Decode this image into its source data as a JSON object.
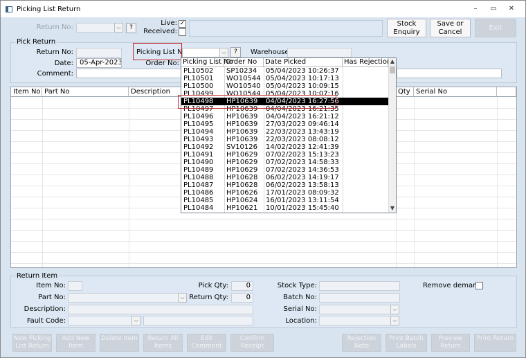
{
  "window": {
    "title": "Picking List Return"
  },
  "top": {
    "return_no_label": "Return No:",
    "live_label": "Live:",
    "received_label": "Received:",
    "help": "?",
    "stock_enquiry": "Stock Enquiry",
    "save_cancel": "Save or Cancel",
    "exit": "Exit"
  },
  "pick_return": {
    "title": "Pick Return",
    "return_no_label": "Return No:",
    "date_label": "Date:",
    "date_value": "05-Apr-2023",
    "comment_label": "Comment:",
    "picking_list_label": "Picking List No:",
    "order_no_label": "Order No:",
    "warehouse_label": "Warehouse:",
    "help": "?"
  },
  "grid": {
    "columns": [
      "Item No",
      "Part No",
      "Description",
      "Qty",
      "Serial No"
    ]
  },
  "picking_dropdown": {
    "columns": [
      "Picking List No",
      "Order No",
      "Date Picked",
      "Has Rejections"
    ],
    "rows": [
      [
        "PL10502",
        "SP10234",
        "05/04/2023 10:26:37"
      ],
      [
        "PL10501",
        "WO10544",
        "05/04/2023 10:17:13"
      ],
      [
        "PL10500",
        "WO10540",
        "05/04/2023 10:09:15"
      ],
      [
        "PL10499",
        "WO10544",
        "05/04/2023 10:07:16"
      ],
      [
        "PL10498",
        "HP10639",
        "04/04/2023 16:27:56"
      ],
      [
        "PL10497",
        "HP10639",
        "04/04/2023 16:21:35"
      ],
      [
        "PL10496",
        "HP10639",
        "04/04/2023 16:21:12"
      ],
      [
        "PL10495",
        "HP10639",
        "27/03/2023 09:46:14"
      ],
      [
        "PL10494",
        "HP10639",
        "22/03/2023 13:43:19"
      ],
      [
        "PL10493",
        "HP10639",
        "22/03/2023 08:08:12"
      ],
      [
        "PL10492",
        "SV10126",
        "14/02/2023 12:41:39"
      ],
      [
        "PL10491",
        "HP10629",
        "07/02/2023 15:13:23"
      ],
      [
        "PL10490",
        "HP10629",
        "07/02/2023 14:58:33"
      ],
      [
        "PL10489",
        "HP10629",
        "07/02/2023 14:36:53"
      ],
      [
        "PL10488",
        "HP10628",
        "06/02/2023 14:19:17"
      ],
      [
        "PL10487",
        "HP10628",
        "06/02/2023 13:58:13"
      ],
      [
        "PL10486",
        "HP10626",
        "17/01/2023 08:09:32"
      ],
      [
        "PL10485",
        "HP10624",
        "16/01/2023 13:11:54"
      ],
      [
        "PL10484",
        "HP10621",
        "10/01/2023 15:45:40"
      ]
    ],
    "selected_index": 4
  },
  "return_item": {
    "title": "Return Item",
    "item_no_label": "Item No:",
    "part_no_label": "Part No:",
    "description_label": "Description:",
    "fault_code_label": "Fault Code:",
    "pick_qty_label": "Pick Qty:",
    "pick_qty_value": "0",
    "return_qty_label": "Return Qty:",
    "return_qty_value": "0",
    "stock_type_label": "Stock Type:",
    "batch_no_label": "Batch No:",
    "serial_no_label": "Serial No:",
    "location_label": "Location:",
    "remove_demand_label": "Remove demand:"
  },
  "bottom_buttons": {
    "new_picking": "New Picking List Return",
    "add_new": "Add New Item",
    "delete_item": "Delete Item",
    "return_all": "Return All Items",
    "edit_comment": "Edit Comment",
    "confirm_receipt": "Confirm Receipt",
    "rejection_note": "Rejection Note",
    "print_batch": "Print Batch Labels",
    "preview_return": "Preview Return",
    "print_return": "Print Return"
  },
  "icons": {
    "check": "✓",
    "dropdown": "⌵",
    "minimize": "–",
    "restore": "▭",
    "close": "✕"
  },
  "colors": {
    "window_bg": "#d9e4f1",
    "selected_row": "#000000",
    "highlight_box": "#c0272d"
  }
}
